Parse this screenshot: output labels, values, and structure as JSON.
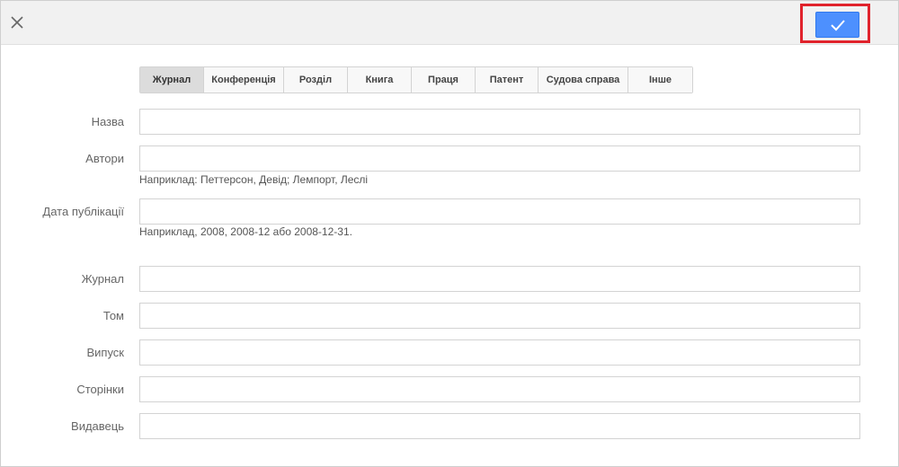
{
  "tabs": [
    {
      "label": "Журнал",
      "active": true
    },
    {
      "label": "Конференція",
      "active": false
    },
    {
      "label": "Розділ",
      "active": false
    },
    {
      "label": "Книга",
      "active": false
    },
    {
      "label": "Праця",
      "active": false
    },
    {
      "label": "Патент",
      "active": false
    },
    {
      "label": "Судова справа",
      "active": false
    },
    {
      "label": "Інше",
      "active": false
    }
  ],
  "fields": {
    "title": {
      "label": "Назва",
      "value": ""
    },
    "authors": {
      "label": "Автори",
      "value": "",
      "hint": "Наприклад: Петтерсон, Девід; Лемпорт, Леслі"
    },
    "date": {
      "label": "Дата публікації",
      "value": "",
      "hint": "Наприклад, 2008, 2008-12 або 2008-12-31."
    },
    "journal": {
      "label": "Журнал",
      "value": ""
    },
    "volume": {
      "label": "Том",
      "value": ""
    },
    "issue": {
      "label": "Випуск",
      "value": ""
    },
    "pages": {
      "label": "Сторінки",
      "value": ""
    },
    "publisher": {
      "label": "Видавець",
      "value": ""
    }
  },
  "icons": {
    "close": "close-icon",
    "confirm": "checkmark-icon"
  },
  "colors": {
    "accent": "#4d90fe",
    "highlight": "#e0232c"
  }
}
